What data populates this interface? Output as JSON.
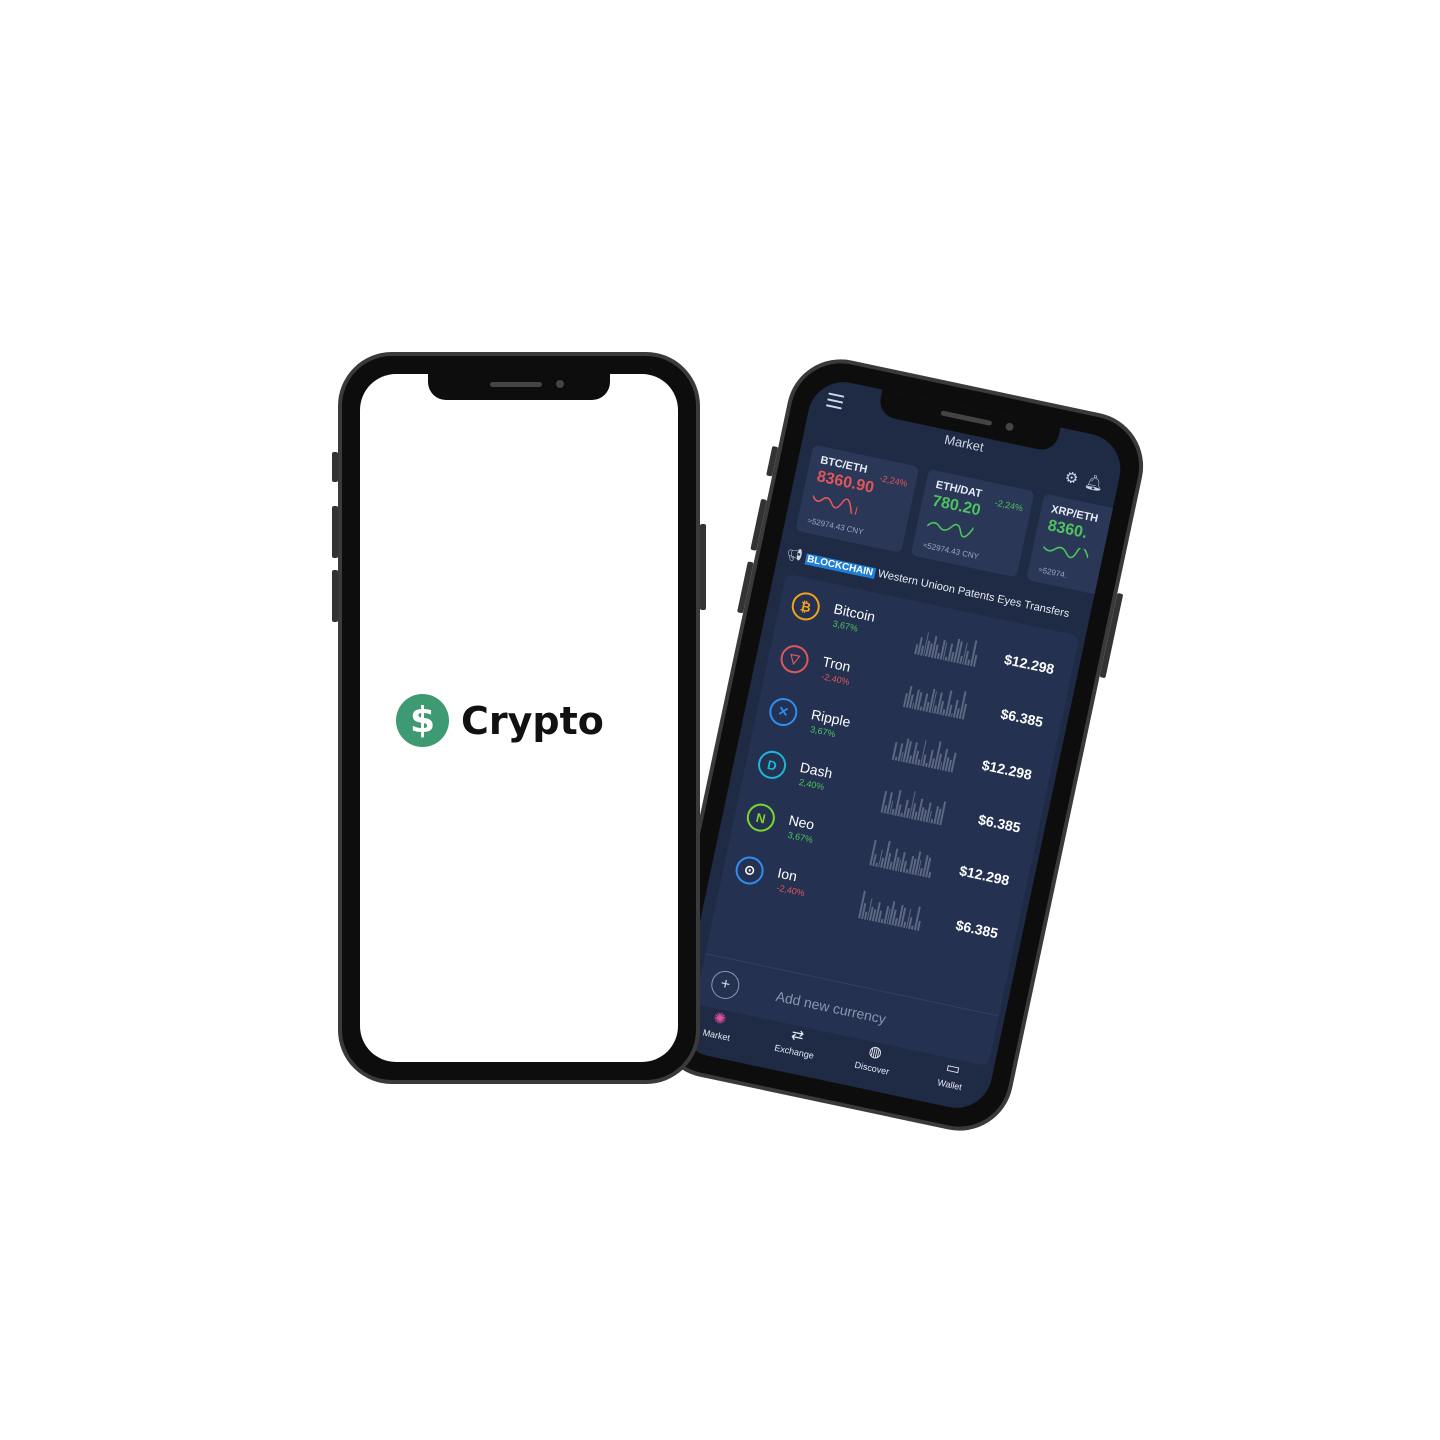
{
  "splash": {
    "logo_symbol": "$",
    "logo_text": "Crypto",
    "brand_color": "#3e9a70"
  },
  "market": {
    "header_title": "Market",
    "tickers": [
      {
        "pair": "BTC/ETH",
        "change": "-2,24%",
        "price": "8360.90",
        "cny": "≈52974.43 CNY",
        "trend": "down"
      },
      {
        "pair": "ETH/DAT",
        "change": "-2,24%",
        "price": "780.20",
        "cny": "≈52974.43 CNY",
        "trend": "up"
      },
      {
        "pair": "XRP/ETH",
        "change": "",
        "price": "8360.",
        "cny": "≈52974.",
        "trend": "up"
      }
    ],
    "news": {
      "tag": "BLOCKCHAIN",
      "headline": "Western Unioon Patents Eyes Transfers"
    },
    "coins": [
      {
        "name": "Bitcoin",
        "change": "3,67%",
        "price": "$12.298",
        "icon": "bitcoin-icon",
        "positive": true
      },
      {
        "name": "Tron",
        "change": "-2,40%",
        "price": "$6.385",
        "icon": "tron-icon",
        "positive": false
      },
      {
        "name": "Ripple",
        "change": "3,67%",
        "price": "$12.298",
        "icon": "ripple-icon",
        "positive": true
      },
      {
        "name": "Dash",
        "change": "2,40%",
        "price": "$6.385",
        "icon": "dash-icon",
        "positive": true
      },
      {
        "name": "Neo",
        "change": "3,67%",
        "price": "$12.298",
        "icon": "neo-icon",
        "positive": true
      },
      {
        "name": "Ion",
        "change": "-2,40%",
        "price": "$6.385",
        "icon": "ion-icon",
        "positive": false
      }
    ],
    "add_currency_label": "Add new currency",
    "nav": [
      {
        "label": "Market",
        "icon": "market-icon",
        "active": true
      },
      {
        "label": "Exchange",
        "icon": "exchange-icon",
        "active": false
      },
      {
        "label": "Discover",
        "icon": "globe-icon",
        "active": false
      },
      {
        "label": "Wallet",
        "icon": "wallet-icon",
        "active": false
      }
    ],
    "colors": {
      "background": "#1f2a44",
      "positive": "#4cc35f",
      "negative": "#e0575b",
      "accent": "#e0509a"
    }
  }
}
